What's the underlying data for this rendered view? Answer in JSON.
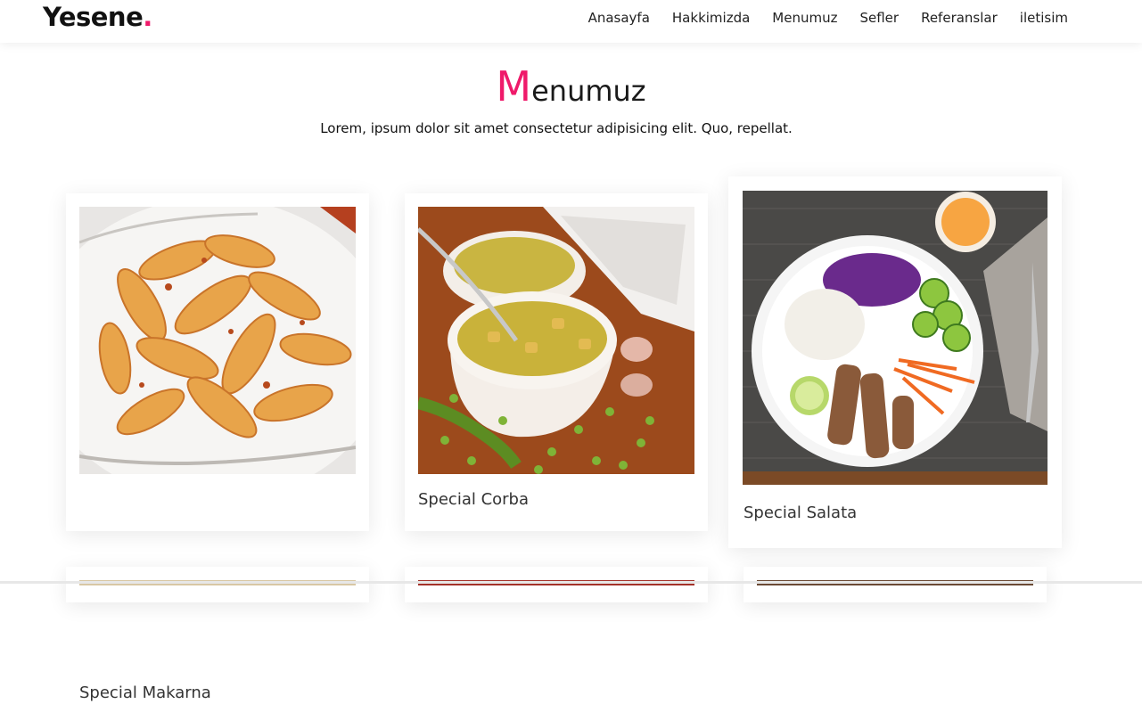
{
  "brand": {
    "name": "Yesene",
    "dot": ".",
    "accent_color": "#ef1a6a"
  },
  "nav": {
    "items": [
      "Anasayfa",
      "Hakkimizda",
      "Menumuz",
      "Sefler",
      "Referanslar",
      "iletisim"
    ]
  },
  "section": {
    "title_first_letter": "M",
    "title_rest": "enumuz",
    "subtitle": "Lorem, ipsum dolor sit amet consectetur adipisicing elit. Quo, repellat."
  },
  "menu_items": [
    {
      "name": "Special Makarna",
      "image": "pasta-fusilli-photo"
    },
    {
      "name": "Special Corba",
      "image": "soup-bowl-photo"
    },
    {
      "name": "Special Salata",
      "image": "salad-plate-photo"
    }
  ]
}
